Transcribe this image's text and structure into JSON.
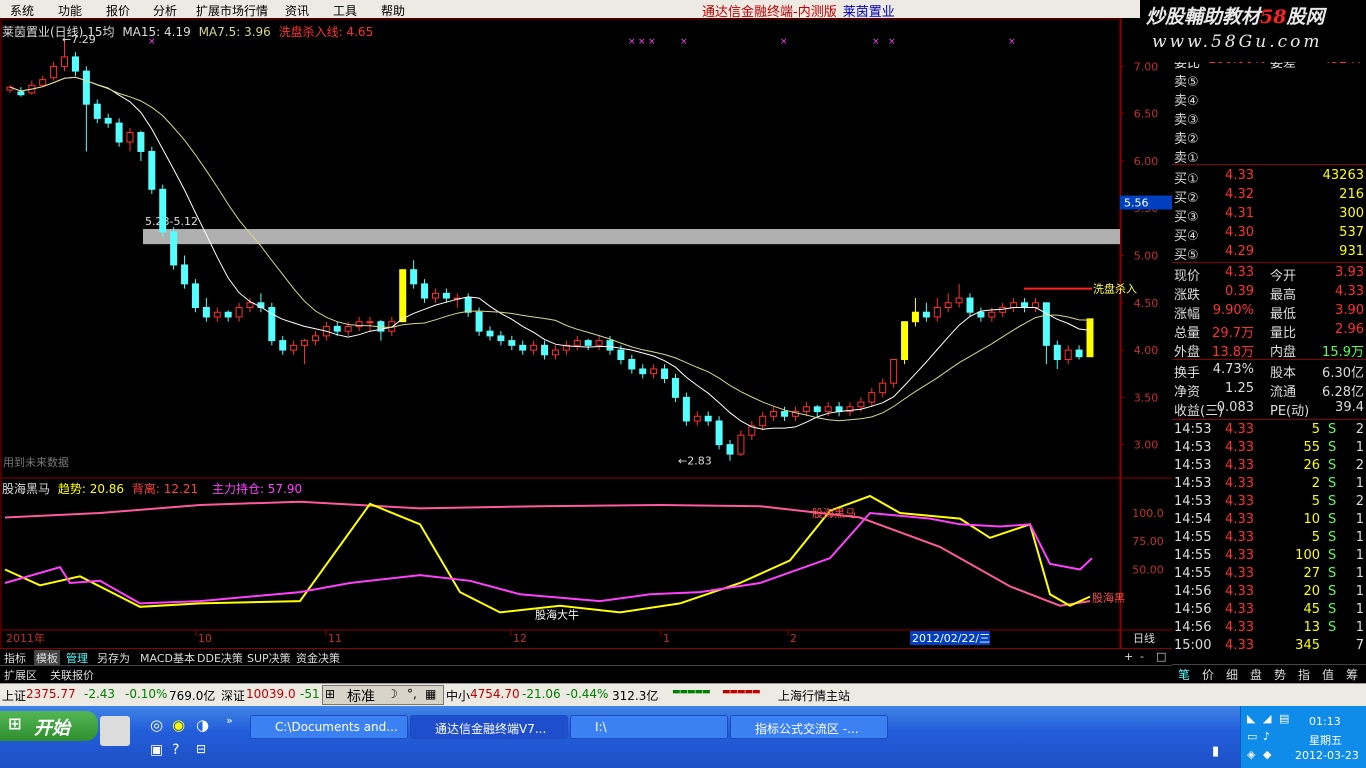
{
  "menu": [
    "系统",
    "功能",
    "报价",
    "分析",
    "扩展市场行情",
    "资讯",
    "工具",
    "帮助"
  ],
  "app_title": "通达信金融终端-内测版",
  "stock_title": "莱茵置业",
  "watermark": {
    "line1_a": "炒股輔助教材",
    "line1_b": "58",
    "line1_c": "股网",
    "line2": "www.58Gu.com"
  },
  "chart_header": {
    "name": "莱茵置业(日线)",
    "ma_labels": [
      "15均",
      "MA15: 4.19",
      "MA7.5: 3.96",
      "洗盘杀入线: 4.65"
    ]
  },
  "indicator_header": {
    "name": "股海黑马",
    "items": [
      "趋势: 20.86",
      "背离: 12.21",
      "主力持仓: 57.90"
    ]
  },
  "annotations": {
    "high": "7.29",
    "level": "5.28-5.12",
    "low": "2.83",
    "future": "用到未来数据",
    "wash_line": "洗盘杀入",
    "black_horse": "股海黑马",
    "bull": "股海大牛",
    "black_horse_right": "股海黑",
    "cursor_price": "5.56"
  },
  "colors": {
    "up": "#ff3030",
    "down": "#54ffff",
    "ma1": "#ffffff",
    "ma2": "#d9d78a",
    "band": "#b0b0b0",
    "yellow": "#ffff00",
    "magenta": "#ff40ff",
    "pink": "#ff5a9e"
  },
  "price_axis": [
    "7.00",
    "6.50",
    "6.00",
    "5.50",
    "5.00",
    "4.50",
    "4.00",
    "3.50",
    "3.00"
  ],
  "ind_axis": [
    "100.0",
    "75.00",
    "50.00"
  ],
  "date_axis": {
    "first": "2011年",
    "months": [
      "10",
      "11",
      "12",
      "1",
      "2"
    ],
    "selected": "2012/02/22/三",
    "period": "日线"
  },
  "tabs1": [
    "指标",
    "模板",
    "管理",
    "另存为",
    "MACD基本",
    "DDE决策",
    "SUP决策",
    "资金决策"
  ],
  "tabs2": [
    "扩展区",
    "关联报价"
  ],
  "chart_data": {
    "type": "candlestick",
    "title": "莱茵置业(日线)",
    "ylim": [
      2.7,
      7.3
    ],
    "x_labels": [
      "2011年",
      "10",
      "11",
      "12",
      "1",
      "2"
    ],
    "high": 7.29,
    "low": 2.83,
    "candles": [
      [
        6.75,
        6.78,
        6.72,
        6.8
      ],
      [
        6.73,
        6.7,
        6.68,
        6.78
      ],
      [
        6.72,
        6.8,
        6.7,
        6.85
      ],
      [
        6.8,
        6.86,
        6.78,
        6.9
      ],
      [
        6.88,
        7.0,
        6.85,
        7.05
      ],
      [
        7.0,
        7.1,
        6.95,
        7.29
      ],
      [
        7.1,
        6.95,
        6.9,
        7.15
      ],
      [
        6.95,
        6.6,
        6.1,
        7.0
      ],
      [
        6.6,
        6.45,
        6.4,
        6.65
      ],
      [
        6.45,
        6.4,
        6.35,
        6.5
      ],
      [
        6.4,
        6.2,
        6.15,
        6.45
      ],
      [
        6.2,
        6.3,
        6.1,
        6.35
      ],
      [
        6.3,
        6.1,
        6.0,
        6.32
      ],
      [
        6.1,
        5.7,
        5.65,
        6.15
      ],
      [
        5.7,
        5.25,
        5.2,
        5.75
      ],
      [
        5.25,
        4.9,
        4.85,
        5.3
      ],
      [
        4.9,
        4.7,
        4.65,
        5.0
      ],
      [
        4.7,
        4.45,
        4.4,
        4.75
      ],
      [
        4.45,
        4.35,
        4.3,
        4.55
      ],
      [
        4.35,
        4.4,
        4.3,
        4.45
      ],
      [
        4.4,
        4.35,
        4.3,
        4.42
      ],
      [
        4.35,
        4.45,
        4.3,
        4.5
      ],
      [
        4.45,
        4.5,
        4.4,
        4.55
      ],
      [
        4.5,
        4.45,
        4.4,
        4.6
      ],
      [
        4.45,
        4.1,
        4.05,
        4.5
      ],
      [
        4.1,
        4.0,
        3.95,
        4.15
      ],
      [
        4.0,
        4.05,
        3.95,
        4.1
      ],
      [
        4.05,
        4.1,
        3.85,
        4.12
      ],
      [
        4.1,
        4.15,
        4.05,
        4.2
      ],
      [
        4.15,
        4.25,
        4.1,
        4.3
      ],
      [
        4.25,
        4.2,
        4.15,
        4.3
      ],
      [
        4.2,
        4.25,
        4.15,
        4.3
      ],
      [
        4.25,
        4.3,
        4.2,
        4.35
      ],
      [
        4.3,
        4.3,
        4.2,
        4.35
      ],
      [
        4.3,
        4.2,
        4.1,
        4.32
      ],
      [
        4.2,
        4.3,
        4.15,
        4.35
      ],
      [
        4.3,
        4.85,
        4.3,
        4.85
      ],
      [
        4.85,
        4.7,
        4.65,
        4.95
      ],
      [
        4.7,
        4.55,
        4.5,
        4.75
      ],
      [
        4.55,
        4.6,
        4.5,
        4.65
      ],
      [
        4.6,
        4.55,
        4.5,
        4.65
      ],
      [
        4.55,
        4.55,
        4.45,
        4.6
      ],
      [
        4.55,
        4.4,
        4.35,
        4.6
      ],
      [
        4.4,
        4.2,
        4.15,
        4.45
      ],
      [
        4.2,
        4.15,
        4.1,
        4.25
      ],
      [
        4.15,
        4.1,
        4.05,
        4.2
      ],
      [
        4.1,
        4.05,
        4.0,
        4.15
      ],
      [
        4.05,
        4.0,
        3.95,
        4.1
      ],
      [
        4.0,
        4.05,
        3.95,
        4.1
      ],
      [
        4.05,
        3.95,
        3.9,
        4.1
      ],
      [
        3.95,
        4.0,
        3.9,
        4.05
      ],
      [
        4.0,
        4.05,
        3.95,
        4.1
      ],
      [
        4.05,
        4.1,
        4.0,
        4.15
      ],
      [
        4.1,
        4.05,
        4.0,
        4.12
      ],
      [
        4.05,
        4.1,
        4.0,
        4.15
      ],
      [
        4.1,
        4.0,
        3.95,
        4.15
      ],
      [
        4.0,
        3.9,
        3.85,
        4.05
      ],
      [
        3.9,
        3.8,
        3.75,
        3.95
      ],
      [
        3.8,
        3.75,
        3.7,
        3.85
      ],
      [
        3.75,
        3.8,
        3.7,
        3.85
      ],
      [
        3.8,
        3.7,
        3.65,
        3.85
      ],
      [
        3.7,
        3.5,
        3.45,
        3.75
      ],
      [
        3.5,
        3.25,
        3.2,
        3.55
      ],
      [
        3.25,
        3.3,
        3.2,
        3.35
      ],
      [
        3.3,
        3.25,
        3.2,
        3.35
      ],
      [
        3.25,
        3.0,
        2.95,
        3.3
      ],
      [
        3.0,
        2.9,
        2.83,
        3.05
      ],
      [
        2.9,
        3.1,
        2.88,
        3.15
      ],
      [
        3.1,
        3.2,
        3.05,
        3.25
      ],
      [
        3.2,
        3.3,
        3.15,
        3.35
      ],
      [
        3.3,
        3.35,
        3.25,
        3.4
      ],
      [
        3.35,
        3.3,
        3.25,
        3.4
      ],
      [
        3.3,
        3.35,
        3.25,
        3.4
      ],
      [
        3.35,
        3.4,
        3.3,
        3.45
      ],
      [
        3.4,
        3.35,
        3.3,
        3.42
      ],
      [
        3.35,
        3.4,
        3.3,
        3.45
      ],
      [
        3.4,
        3.35,
        3.3,
        3.45
      ],
      [
        3.35,
        3.4,
        3.3,
        3.45
      ],
      [
        3.4,
        3.45,
        3.35,
        3.5
      ],
      [
        3.45,
        3.55,
        3.4,
        3.6
      ],
      [
        3.55,
        3.65,
        3.5,
        3.7
      ],
      [
        3.65,
        3.9,
        3.6,
        3.9
      ],
      [
        3.9,
        4.3,
        3.85,
        4.3
      ],
      [
        4.3,
        4.4,
        4.25,
        4.55
      ],
      [
        4.4,
        4.35,
        4.3,
        4.5
      ],
      [
        4.35,
        4.45,
        4.3,
        4.55
      ],
      [
        4.45,
        4.5,
        4.4,
        4.6
      ],
      [
        4.5,
        4.55,
        4.45,
        4.7
      ],
      [
        4.55,
        4.4,
        4.35,
        4.6
      ],
      [
        4.4,
        4.35,
        4.3,
        4.45
      ],
      [
        4.35,
        4.4,
        4.3,
        4.45
      ],
      [
        4.4,
        4.45,
        4.35,
        4.5
      ],
      [
        4.45,
        4.5,
        4.4,
        4.55
      ],
      [
        4.5,
        4.45,
        4.4,
        4.55
      ],
      [
        4.45,
        4.5,
        4.4,
        4.55
      ],
      [
        4.5,
        4.05,
        3.85,
        4.5
      ],
      [
        4.05,
        3.9,
        3.8,
        4.1
      ],
      [
        3.9,
        4.0,
        3.85,
        4.05
      ],
      [
        4.0,
        3.93,
        3.9,
        4.05
      ],
      [
        3.93,
        4.33,
        3.93,
        4.33
      ]
    ]
  },
  "quote": {
    "ratio_label": "委比",
    "ratio_value": "100.00%",
    "diff_label": "委差",
    "diff_value": "45247",
    "sells": [
      {
        "label": "卖⑤"
      },
      {
        "label": "卖④"
      },
      {
        "label": "卖③"
      },
      {
        "label": "卖②"
      },
      {
        "label": "卖①"
      }
    ],
    "buys": [
      {
        "label": "买①",
        "price": "4.33",
        "vol": "43263"
      },
      {
        "label": "买②",
        "price": "4.32",
        "vol": "216"
      },
      {
        "label": "买③",
        "price": "4.31",
        "vol": "300"
      },
      {
        "label": "买④",
        "price": "4.30",
        "vol": "537"
      },
      {
        "label": "买⑤",
        "price": "4.29",
        "vol": "931"
      }
    ],
    "stats": [
      {
        "l1": "现价",
        "v1": "4.33",
        "l2": "今开",
        "v2": "3.93"
      },
      {
        "l1": "涨跌",
        "v1": "0.39",
        "l2": "最高",
        "v2": "4.33"
      },
      {
        "l1": "涨幅",
        "v1": "9.90%",
        "l2": "最低",
        "v2": "3.90"
      },
      {
        "l1": "总量",
        "v1": "29.7万",
        "l2": "量比",
        "v2": "2.96"
      },
      {
        "l1": "外盘",
        "v1": "13.8万",
        "l2": "内盘",
        "v2": "15.9万"
      }
    ],
    "stats2": [
      {
        "l1": "换手",
        "v1": "4.73%",
        "l2": "股本",
        "v2": "6.30亿"
      },
      {
        "l1": "净资",
        "v1": "1.25",
        "l2": "流通",
        "v2": "6.28亿"
      },
      {
        "l1": "收益(三)",
        "v1": "0.083",
        "l2": "PE(动)",
        "v2": "39.4"
      }
    ],
    "ticks": [
      {
        "t": "14:53",
        "p": "4.33",
        "v": "5",
        "s": "S",
        "n": "2"
      },
      {
        "t": "14:53",
        "p": "4.33",
        "v": "55",
        "s": "S",
        "n": "1"
      },
      {
        "t": "14:53",
        "p": "4.33",
        "v": "26",
        "s": "S",
        "n": "2"
      },
      {
        "t": "14:53",
        "p": "4.33",
        "v": "2",
        "s": "S",
        "n": "1"
      },
      {
        "t": "14:53",
        "p": "4.33",
        "v": "5",
        "s": "S",
        "n": "2"
      },
      {
        "t": "14:54",
        "p": "4.33",
        "v": "10",
        "s": "S",
        "n": "1"
      },
      {
        "t": "14:55",
        "p": "4.33",
        "v": "5",
        "s": "S",
        "n": "1"
      },
      {
        "t": "14:55",
        "p": "4.33",
        "v": "100",
        "s": "S",
        "n": "1"
      },
      {
        "t": "14:55",
        "p": "4.33",
        "v": "27",
        "s": "S",
        "n": "1"
      },
      {
        "t": "14:56",
        "p": "4.33",
        "v": "20",
        "s": "S",
        "n": "1"
      },
      {
        "t": "14:56",
        "p": "4.33",
        "v": "45",
        "s": "S",
        "n": "1"
      },
      {
        "t": "14:56",
        "p": "4.33",
        "v": "13",
        "s": "S",
        "n": "1"
      },
      {
        "t": "15:00",
        "p": "4.33",
        "v": "345",
        "s": "",
        "n": "7"
      }
    ],
    "bottom_tabs": [
      "笔",
      "价",
      "细",
      "盘",
      "势",
      "指",
      "值",
      "筹"
    ]
  },
  "status": {
    "sh": "上证",
    "sh_val": "2375.77",
    "sh_chg": "-2.43",
    "sh_pct": "-0.10%",
    "sh_amt": "769.0亿",
    "sz": "深证",
    "sz_val": "10039.0",
    "sz_chg": "-51",
    "ime": "标准",
    "zx": "中小",
    "zx_val": "4754.70",
    "zx_chg": "-21.06",
    "zx_pct": "-0.44%",
    "zx_amt": "312.3亿",
    "server": "上海行情主站"
  },
  "taskbar": {
    "start": "开始",
    "tasks": [
      "C:\\Documents and...",
      "通达信金融终端V7...",
      "I:\\",
      "指标公式交流区 -..."
    ],
    "time": "01:13",
    "day": "星期五",
    "date": "2012-03-23"
  }
}
